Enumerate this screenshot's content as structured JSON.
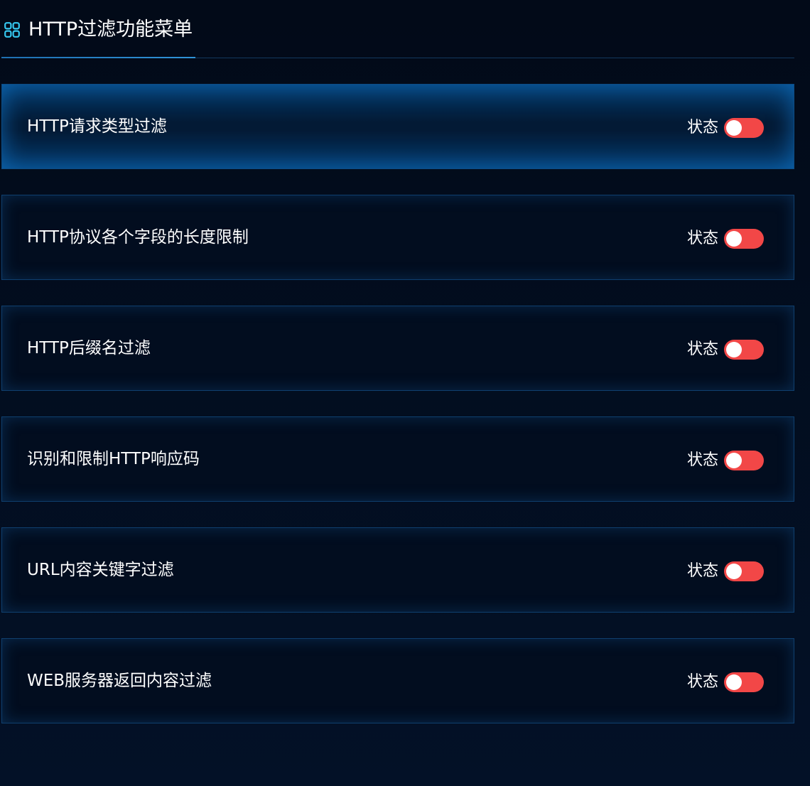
{
  "header": {
    "title": "HTTP过滤功能菜单",
    "icon": "apps-grid-icon",
    "accent_color": "#35c7ef"
  },
  "items": [
    {
      "label": "HTTP请求类型过滤",
      "status_label": "状态",
      "enabled": false,
      "active": true
    },
    {
      "label": "HTTP协议各个字段的长度限制",
      "status_label": "状态",
      "enabled": false,
      "active": false
    },
    {
      "label": "HTTP后缀名过滤",
      "status_label": "状态",
      "enabled": false,
      "active": false
    },
    {
      "label": "识别和限制HTTP响应码",
      "status_label": "状态",
      "enabled": false,
      "active": false
    },
    {
      "label": "URL内容关键字过滤",
      "status_label": "状态",
      "enabled": false,
      "active": false
    },
    {
      "label": "WEB服务器返回内容过滤",
      "status_label": "状态",
      "enabled": false,
      "active": false
    }
  ],
  "colors": {
    "background": "#020d1f",
    "active_background": "#04396a",
    "toggle_off": "#f24747",
    "border": "#0f3f6e"
  }
}
